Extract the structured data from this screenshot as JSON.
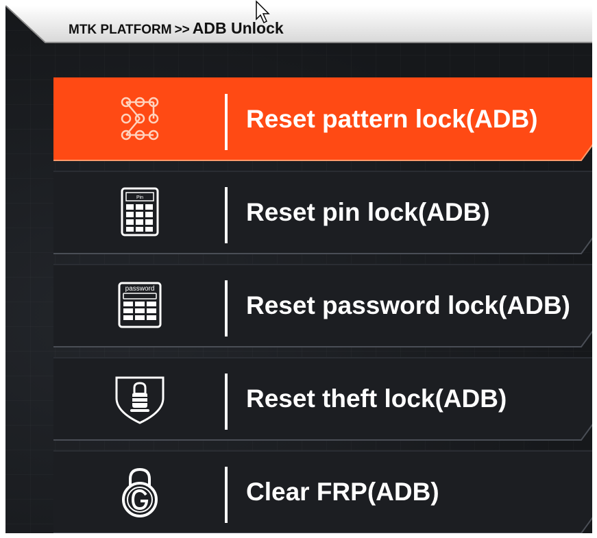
{
  "breadcrumb": {
    "platform": "MTK PLATFORM",
    "separator": ">>",
    "current": "ADB Unlock"
  },
  "menu": {
    "items": [
      {
        "label": "Reset pattern lock(ADB)",
        "icon": "pattern-lock-icon",
        "selected": true
      },
      {
        "label": "Reset pin lock(ADB)",
        "icon": "pin-keypad-icon",
        "selected": false
      },
      {
        "label": "Reset password lock(ADB)",
        "icon": "password-keypad-icon",
        "selected": false
      },
      {
        "label": "Reset theft lock(ADB)",
        "icon": "shield-lock-icon",
        "selected": false
      },
      {
        "label": "Clear FRP(ADB)",
        "icon": "google-lock-icon",
        "selected": false
      }
    ],
    "icon_text": {
      "pin": "Pin",
      "password": "password"
    }
  },
  "colors": {
    "selected_bg": "#ff4a14",
    "item_bg": "#1c1e22",
    "text": "#ffffff",
    "frame_bg": "#1a1c20"
  }
}
